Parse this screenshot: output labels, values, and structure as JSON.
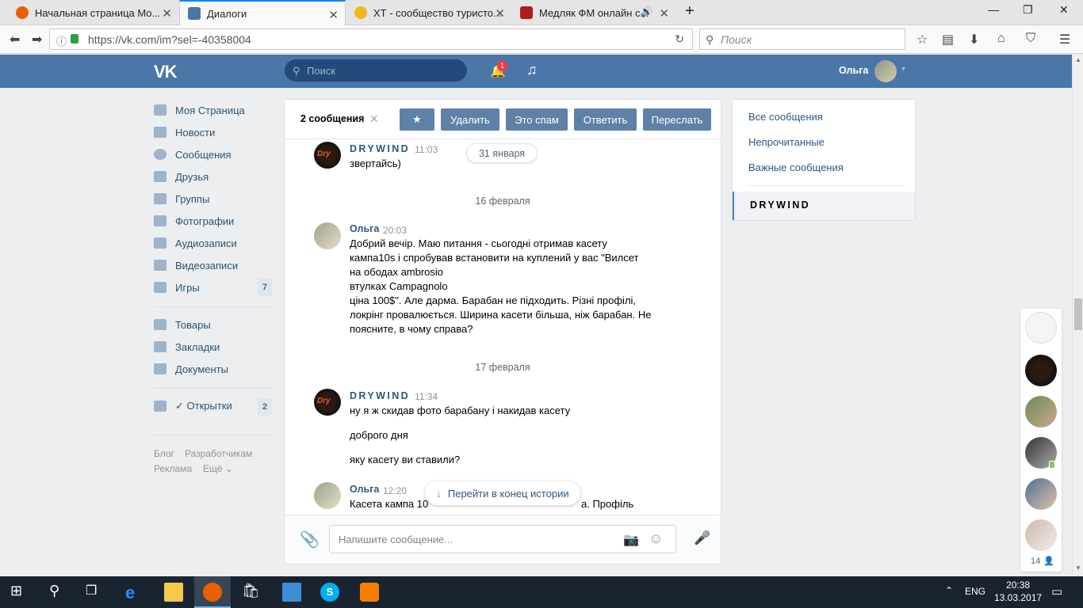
{
  "browser": {
    "tabs": [
      {
        "label": "Начальная страница Mo..."
      },
      {
        "label": "Диалоги"
      },
      {
        "label": "ХТ - сообщество туристо..."
      },
      {
        "label": "Медляк ФМ онлайн с..."
      }
    ],
    "url": "https://vk.com/im?sel=-40358004",
    "search_placeholder": "Поиск"
  },
  "vk": {
    "search_placeholder": "Поиск",
    "notification_count": "1",
    "user_name": "Ольга"
  },
  "left_menu": {
    "items": [
      {
        "label": "Моя Страница"
      },
      {
        "label": "Новости"
      },
      {
        "label": "Сообщения"
      },
      {
        "label": "Друзья"
      },
      {
        "label": "Группы"
      },
      {
        "label": "Фотографии"
      },
      {
        "label": "Аудиозаписи"
      },
      {
        "label": "Видеозаписи"
      },
      {
        "label": "Игры",
        "badge": "7"
      },
      {
        "label": "Товары"
      },
      {
        "label": "Закладки"
      },
      {
        "label": "Документы"
      },
      {
        "label": "✓ Открытки",
        "badge": "2"
      }
    ],
    "footer": [
      "Блог",
      "Разработчикам",
      "Реклама",
      "Ещё"
    ]
  },
  "toolbar": {
    "selected": "2 сообщения",
    "delete": "Удалить",
    "spam": "Это спам",
    "reply": "Ответить",
    "forward": "Переслать"
  },
  "messages": {
    "m1": {
      "author": "DRYWIND",
      "time": "11:03",
      "text": "звертайсь)"
    },
    "date_pill": "31 января",
    "date1": "16 февраля",
    "m2": {
      "author": "Ольга",
      "time": "20:03",
      "lines": [
        "Добрий вечір. Маю питання - сьогодні отримав касету",
        "кампа10s і спробував встановити на куплений у вас \"Вилсет",
        "на ободах ambrosio",
        "втулках Campagnolo",
        "ціна 100$\". Але дарма. Барабан не підходить. Різні профілі,",
        "локрінг провалюється. Ширина касети більша, ніж барабан. Не",
        "поясните, в чому справа?"
      ]
    },
    "date2": "17 февраля",
    "m3": {
      "author": "DRYWIND",
      "time": "11:34",
      "lines": [
        "ну я ж скидав фото барабану і накидав касету",
        "доброго дня",
        "яку касету ви ставили?"
      ]
    },
    "m4": {
      "author": "Ольга",
      "time": "12:20",
      "text_left": "Касета кампа 10",
      "text_right": "а. Профіль"
    },
    "goto_end": "Перейти в конец истории"
  },
  "compose": {
    "placeholder": "Напишите сообщение..."
  },
  "right_panel": {
    "all": "Все сообщения",
    "unread": "Непрочитанные",
    "important": "Важные сообщения",
    "current": "DRYWIND"
  },
  "friends": {
    "online_count": "14"
  },
  "taskbar": {
    "lang": "ENG",
    "time": "20:38",
    "date": "13.03.2017"
  },
  "colors": {
    "vk_blue": "#4a76a8",
    "button": "#5e81a8",
    "link": "#2a5885"
  }
}
